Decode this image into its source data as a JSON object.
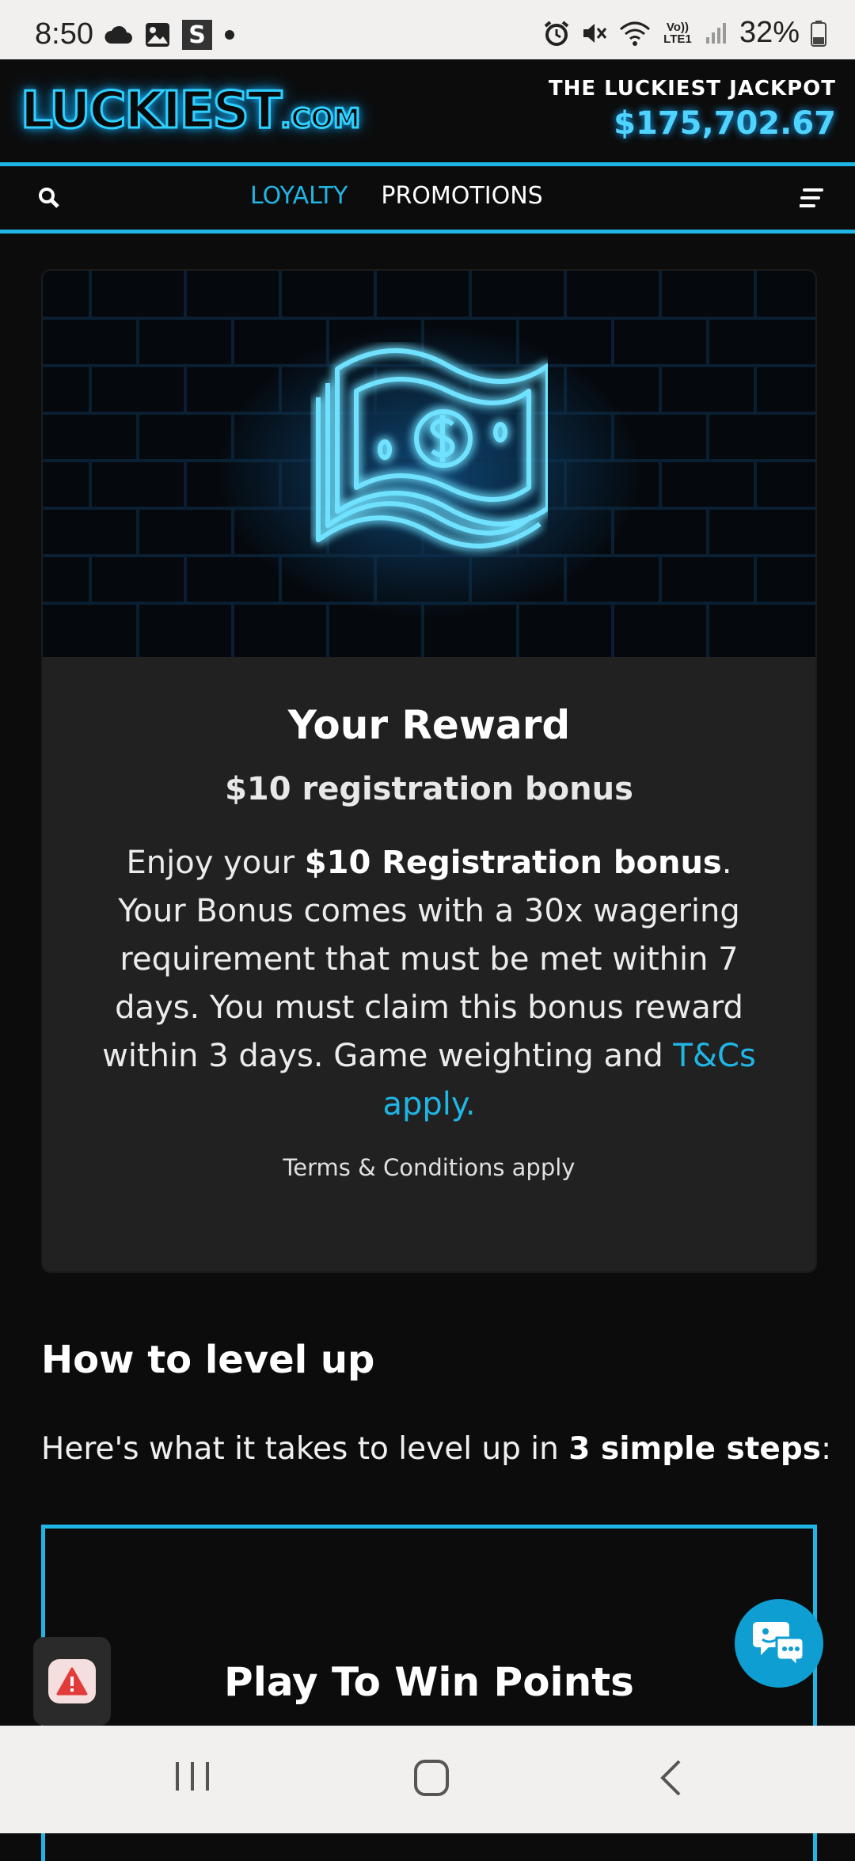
{
  "status_bar": {
    "time": "8:50",
    "battery": "32%",
    "icons": [
      "cloud-icon",
      "image-icon",
      "s-app-icon",
      "dot-icon",
      "alarm-icon",
      "mute-icon",
      "wifi-icon",
      "lte-icon",
      "signal-icon",
      "battery-icon"
    ],
    "s_label": "S",
    "lte_label": "Vo)) LTE1"
  },
  "header": {
    "logo_main": "LUCKIEST",
    "logo_suffix": ".COM",
    "jackpot_title": "THE LUCKIEST JACKPOT",
    "jackpot_amount": "$175,702.67"
  },
  "nav": {
    "loyalty": "LOYALTY",
    "promotions": "PROMOTIONS",
    "search_icon": "search-icon",
    "menu_icon": "menu-icon"
  },
  "reward": {
    "title": "Your Reward",
    "subtitle": "$10 registration bonus",
    "body_1": "Enjoy your ",
    "body_bold": "$10 Registration bonus",
    "body_2": ". Your Bonus comes with a 30x wagering requirement that must be met within 7 days. You must claim this bonus reward within 3 days. Game weighting and ",
    "body_link": "T&Cs apply.",
    "terms": "Terms & Conditions apply"
  },
  "level_up": {
    "title": "How to level up",
    "text_1": "Here's what it takes to level up in ",
    "text_bold": "3 simple steps",
    "text_2": ":",
    "step_title": "Play To Win Points"
  },
  "colors": {
    "accent": "#1fb6e6",
    "background": "#0c0c0c",
    "card": "#212121",
    "chat": "#0f9ed1"
  }
}
